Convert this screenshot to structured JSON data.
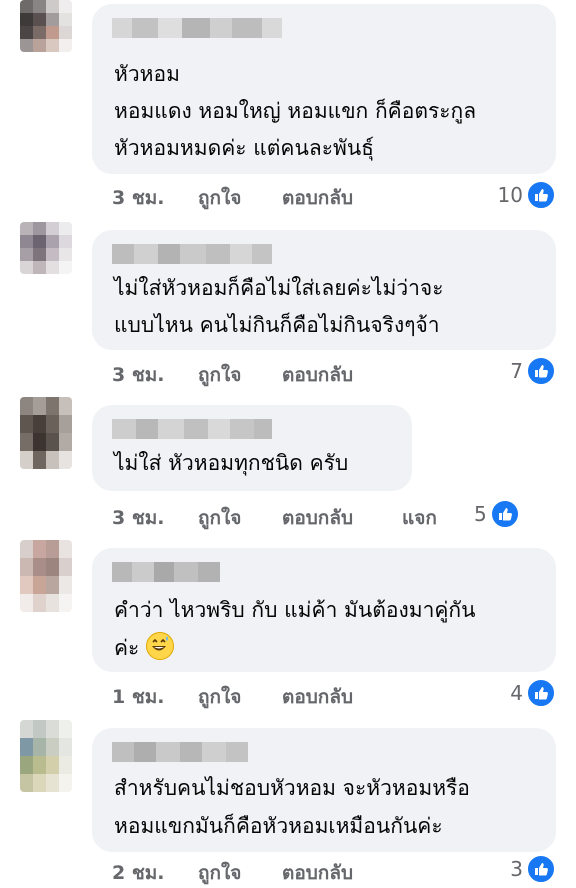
{
  "colors": {
    "bubble": "#f0f2f5",
    "meta": "#65676b",
    "like_blue": "#1877f2"
  },
  "comments": [
    {
      "lines": [
        "หัวหอม",
        "หอมแดง หอมใหญ่ หอมแขก ก็คือตระกูล",
        "หัวหอมหมดค่ะ แต่คนละพันธุ์"
      ],
      "time": "3 ชม.",
      "like_label": "ถูกใจ",
      "reply_label": "ตอบกลับ",
      "reactions": "10",
      "reaction_icon": "like-icon"
    },
    {
      "lines": [
        "ไม่ใส่หัวหอมก็คือไม่ใส่เลยค่ะไม่ว่าจะ",
        "แบบไหน คนไม่กินก็คือไม่กินจริงๆจ้า"
      ],
      "time": "3 ชม.",
      "like_label": "ถูกใจ",
      "reply_label": "ตอบกลับ",
      "reactions": "7",
      "reaction_icon": "like-icon"
    },
    {
      "lines": [
        "ไม่ใส่ หัวหอมทุกชนิด ครับ"
      ],
      "time": "3 ชม.",
      "like_label": "ถูกใจ",
      "reply_label": "ตอบกลับ",
      "share_label": "แจก",
      "reactions": "5",
      "reaction_icon": "like-icon"
    },
    {
      "lines": [
        "คำว่า ไหวพริบ กับ แม่ค้า มันต้องมาคู่กัน",
        "ค่ะ"
      ],
      "emoji": "grinning-sweat-emoji",
      "time": "1 ชม.",
      "like_label": "ถูกใจ",
      "reply_label": "ตอบกลับ",
      "reactions": "4",
      "reaction_icon": "like-icon"
    },
    {
      "lines": [
        "สำหรับคนไม่ชอบหัวหอม จะหัวหอมหรือ",
        "หอมแขกมันก็คือหัวหอมเหมือนกันค่ะ"
      ],
      "time": "2 ชม.",
      "like_label": "ถูกใจ",
      "reply_label": "ตอบกลับ",
      "reactions": "3",
      "reaction_icon": "like-icon"
    }
  ]
}
